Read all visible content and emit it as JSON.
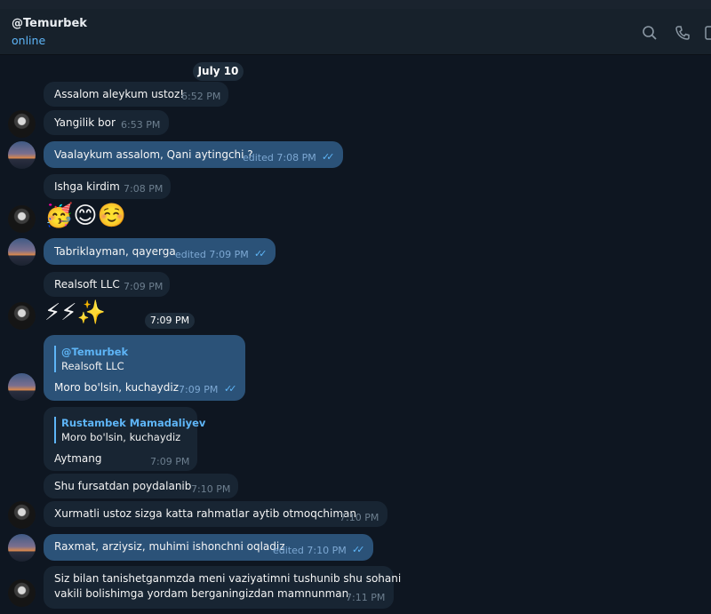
{
  "header": {
    "name": "@Temurbek",
    "status": "online",
    "icons": [
      "search-icon",
      "phone-icon",
      "sidebar-icon"
    ]
  },
  "date_label": "July 10",
  "messages": [
    {
      "text": "Assalom aleykum ustoz!",
      "time": "6:52 PM",
      "dir": "in"
    },
    {
      "text": "Yangilik bor",
      "time": "6:53 PM",
      "dir": "in"
    },
    {
      "text": "Vaalaykum assalom, Qani aytingchi ?",
      "time": "edited 7:08 PM",
      "dir": "out"
    },
    {
      "text": "Ishga kirdim",
      "time": "7:08 PM",
      "dir": "in"
    },
    {
      "text": "🥳😊☺️",
      "time": "",
      "dir": "in",
      "emoji": true
    },
    {
      "text": "Tabriklayman, qayerga",
      "time": "edited 7:09 PM",
      "dir": "out"
    },
    {
      "text": "Realsoft LLC",
      "time": "7:09 PM",
      "dir": "in"
    },
    {
      "text": "⚡⚡✨",
      "time": "7:09 PM",
      "dir": "in",
      "emoji": true
    },
    {
      "text": "Moro bo'lsin, kuchaydiz",
      "time": "7:09 PM",
      "dir": "out",
      "reply_name": "@Temurbek",
      "reply_text": "Realsoft LLC"
    },
    {
      "text": "Aytmang",
      "time": "7:09 PM",
      "dir": "in",
      "reply_name": "Rustambek Mamadaliyev",
      "reply_text": "Moro bo'lsin, kuchaydiz"
    },
    {
      "text": "Shu fursatdan poydalanib",
      "time": "7:10 PM",
      "dir": "in"
    },
    {
      "text": "Xurmatli ustoz sizga katta rahmatlar aytib otmoqchiman",
      "time": "7:10 PM",
      "dir": "in"
    },
    {
      "text": "Raxmat, arziysiz, muhimi ishonchni oqladiz",
      "time": "edited 7:10 PM",
      "dir": "out"
    },
    {
      "text": "Siz bilan tanishetganmzda meni vaziyatimni tushunib shu sohani",
      "text2": "vakili bolishimga yordam berganingizdan mamnunman",
      "time": "7:11 PM",
      "dir": "in"
    }
  ],
  "colors": {
    "background": "#0e1621",
    "incoming": "#182533",
    "outgoing": "#2b5278",
    "accent": "#5eb5f7"
  }
}
